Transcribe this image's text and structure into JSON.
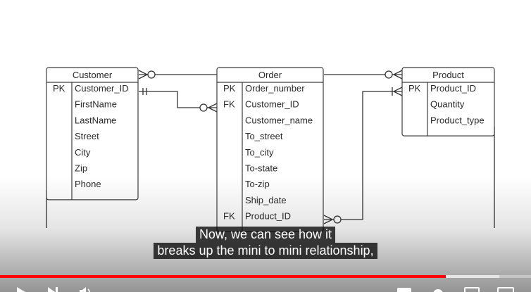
{
  "diagram": {
    "entities": [
      {
        "id": "customer",
        "title": "Customer",
        "fields": [
          {
            "key": "PK",
            "name": "Customer_ID"
          },
          {
            "key": "",
            "name": "FirstName"
          },
          {
            "key": "",
            "name": "LastName"
          },
          {
            "key": "",
            "name": "Street"
          },
          {
            "key": "",
            "name": "City"
          },
          {
            "key": "",
            "name": "Zip"
          },
          {
            "key": "",
            "name": "Phone"
          }
        ]
      },
      {
        "id": "order",
        "title": "Order",
        "fields": [
          {
            "key": "PK",
            "name": "Order_number"
          },
          {
            "key": "FK",
            "name": "Customer_ID"
          },
          {
            "key": "",
            "name": "Customer_name"
          },
          {
            "key": "",
            "name": "To_street"
          },
          {
            "key": "",
            "name": "To_city"
          },
          {
            "key": "",
            "name": "To-state"
          },
          {
            "key": "",
            "name": "To-zip"
          },
          {
            "key": "",
            "name": "Ship_date"
          },
          {
            "key": "FK",
            "name": "Product_ID"
          }
        ]
      },
      {
        "id": "product",
        "title": "Product",
        "fields": [
          {
            "key": "PK",
            "name": "Product_ID"
          },
          {
            "key": "",
            "name": "Quantity"
          },
          {
            "key": "",
            "name": "Product_type"
          }
        ]
      }
    ],
    "relationships": [
      {
        "from": "customer",
        "to": "order",
        "from_cardinality": "zero-or-many",
        "to_cardinality": "none"
      },
      {
        "from": "customer.Customer_ID",
        "to": "order.Customer_ID",
        "from_cardinality": "one-and-only-one",
        "to_cardinality": "zero-or-many"
      },
      {
        "from": "order",
        "to": "product",
        "from_cardinality": "none",
        "to_cardinality": "zero-or-many"
      },
      {
        "from": "order.Product_ID",
        "to": "product.Product_ID",
        "from_cardinality": "zero-or-many",
        "to_cardinality": "one-or-many"
      }
    ],
    "colors": {
      "line": "#333333",
      "text": "#2a2a2a",
      "border": "#3c3c3c"
    }
  },
  "player": {
    "captions": [
      "Now, we can see how it",
      "breaks up the mini to mini relationship,"
    ],
    "progress_fraction": 0.84,
    "buffered_fraction": 0.94,
    "colors": {
      "played": "#ff0000",
      "caption_bg": "#080808"
    },
    "controls": {
      "play_icon": "play-icon",
      "next_icon": "next-icon",
      "volume_icon": "volume-icon",
      "subtitles_icon": "subtitles-icon",
      "settings_icon": "settings-icon",
      "miniplayer_icon": "miniplayer-icon",
      "theater_icon": "theater-icon"
    }
  }
}
